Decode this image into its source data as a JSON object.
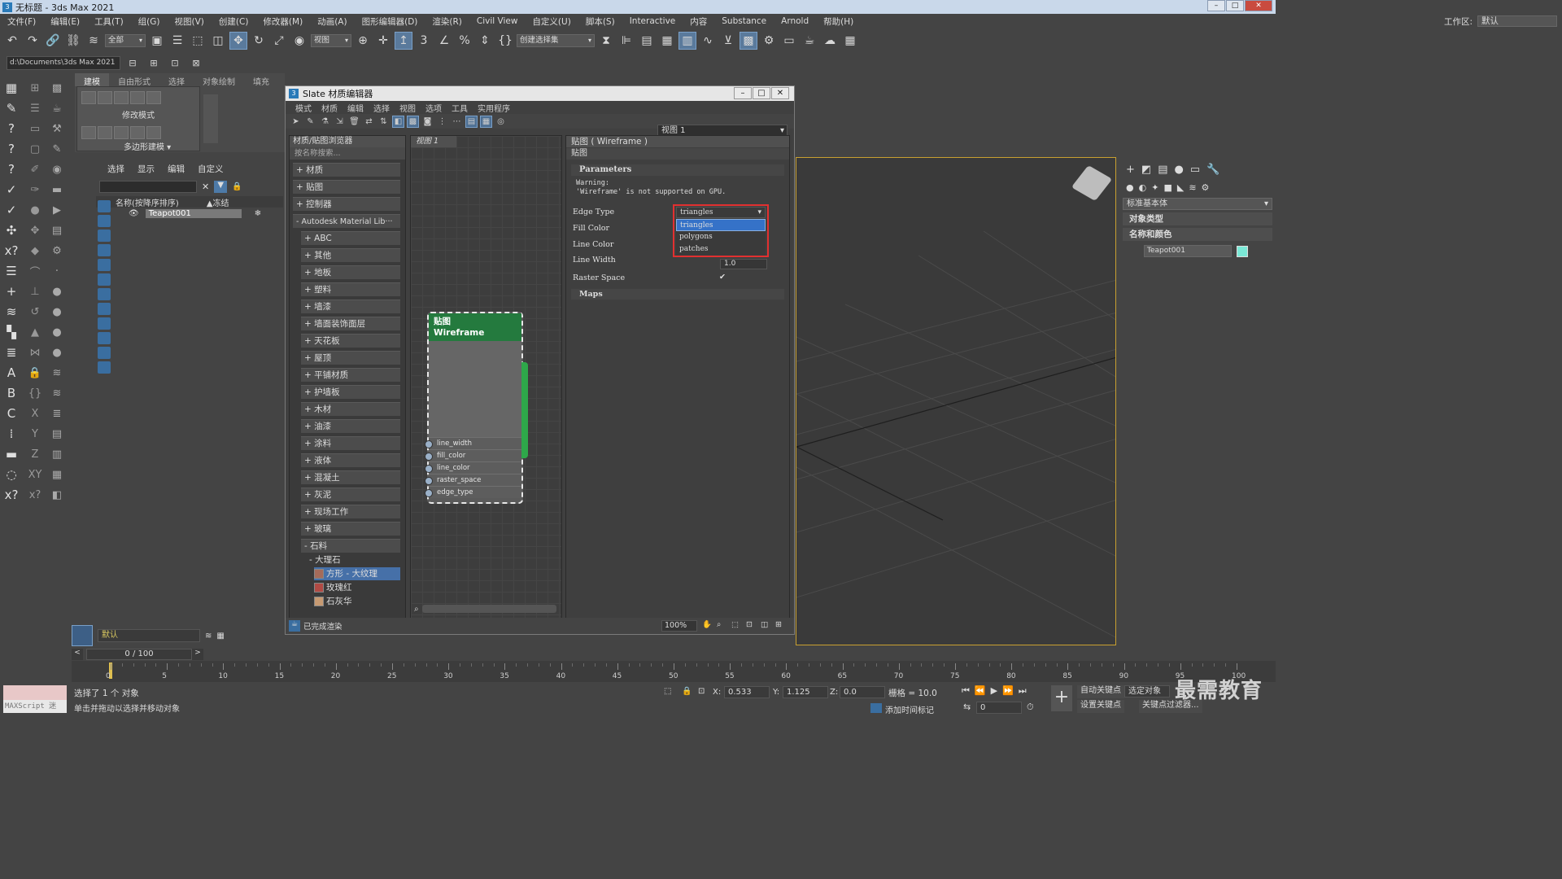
{
  "window": {
    "title": "无标题 - 3ds Max 2021",
    "min": "–",
    "max": "□",
    "close": "✕"
  },
  "menu": [
    "文件(F)",
    "编辑(E)",
    "工具(T)",
    "组(G)",
    "视图(V)",
    "创建(C)",
    "修改器(M)",
    "动画(A)",
    "图形编辑器(D)",
    "渲染(R)",
    "Civil View",
    "自定义(U)",
    "脚本(S)",
    "Interactive",
    "内容",
    "Substance",
    "Arnold",
    "帮助(H)"
  ],
  "workspace": {
    "label": "工作区:",
    "value": "默认"
  },
  "toolbar": {
    "filter": "全部",
    "refcoord": "视图",
    "selset": "创建选择集",
    "path": "d:\\Documents\\3ds Max 2021"
  },
  "ribbon": {
    "tabs": [
      "建模",
      "自由形式",
      "选择",
      "对象绘制",
      "填充"
    ],
    "mode_label": "修改模式",
    "poly_label": "多边形建模 ▾"
  },
  "scene_explorer": {
    "tabs": [
      "选择",
      "显示",
      "编辑",
      "自定义"
    ],
    "col_name": "名称(按降序排序)",
    "col_freeze": "▲冻结",
    "object": "Teapot001"
  },
  "layer": {
    "name": "默认"
  },
  "slate": {
    "title": "Slate 材质编辑器",
    "menu": [
      "模式",
      "材质",
      "编辑",
      "选择",
      "视图",
      "选项",
      "工具",
      "实用程序"
    ],
    "view_select": "视图 1",
    "browser_header": "材质/贴图浏览器",
    "browser_search": "按名称搜索...",
    "categories": [
      "+ 材质",
      "+ 贴图",
      "+ 控制器"
    ],
    "library": "- Autodesk Material Lib···",
    "subs": [
      "+ ABC",
      "+ 其他",
      "+ 地板",
      "+ 塑料",
      "+ 墙漆",
      "+ 墙面装饰面层",
      "+ 天花板",
      "+ 屋顶",
      "+ 平铺材质",
      "+ 护墙板",
      "+ 木材",
      "+ 油漆",
      "+ 涂料",
      "+ 液体",
      "+ 混凝土",
      "+ 灰泥",
      "+ 现场工作",
      "+ 玻璃",
      "- 石料"
    ],
    "marble": "- 大理石",
    "marble_items": [
      "方形 - 大纹理",
      "玫瑰红",
      "石灰华"
    ],
    "canvas_tab": "视图 1",
    "node_title": "贴图",
    "node_subtitle": "Wireframe",
    "ports": [
      "line_width",
      "fill_color",
      "line_color",
      "raster_space",
      "edge_type"
    ],
    "props_header": "贴图 ( Wireframe )",
    "props_sub": "贴图",
    "params_roll": "Parameters",
    "warn1": "Warning:",
    "warn2": "'Wireframe' is not supported on GPU.",
    "labels": [
      "Edge Type",
      "Fill Color",
      "Line Color",
      "Line Width",
      "Raster Space"
    ],
    "line_width": "1.0",
    "raster_check": "✔",
    "maps_roll": "Maps",
    "edge_selected": "triangles",
    "edge_options": [
      "triangles",
      "polygons",
      "patches"
    ],
    "status": "已完成渲染",
    "zoom": "100%"
  },
  "command_panel": {
    "category": "标准基本体",
    "rollouts": [
      "对象类型",
      "名称和颜色"
    ],
    "object": "Teapot001",
    "color": "#7be8d6"
  },
  "timeline": {
    "frame": "0 / 100",
    "ticks": [
      "0",
      "5",
      "10",
      "15",
      "20",
      "25",
      "30",
      "35",
      "40",
      "45",
      "50",
      "55",
      "60",
      "65",
      "70",
      "75",
      "80",
      "85",
      "90",
      "95",
      "100"
    ]
  },
  "status": {
    "maxscript": "MAXScript 迷",
    "line1": "选择了 1 个 对象",
    "line2": "单击并拖动以选择并移动对象",
    "x": "0.533",
    "y": "1.125",
    "z": "0.0",
    "x_label": "X:",
    "y_label": "Y:",
    "z_label": "Z:",
    "grid": "栅格 = 10.0",
    "add_tag": "添加时间标记",
    "autokey": "自动关键点",
    "setkey": "设置关键点",
    "selobj": "选定对象",
    "keyfilter": "关键点过滤器...",
    "frame": "0",
    "watermark": "最需教育"
  }
}
